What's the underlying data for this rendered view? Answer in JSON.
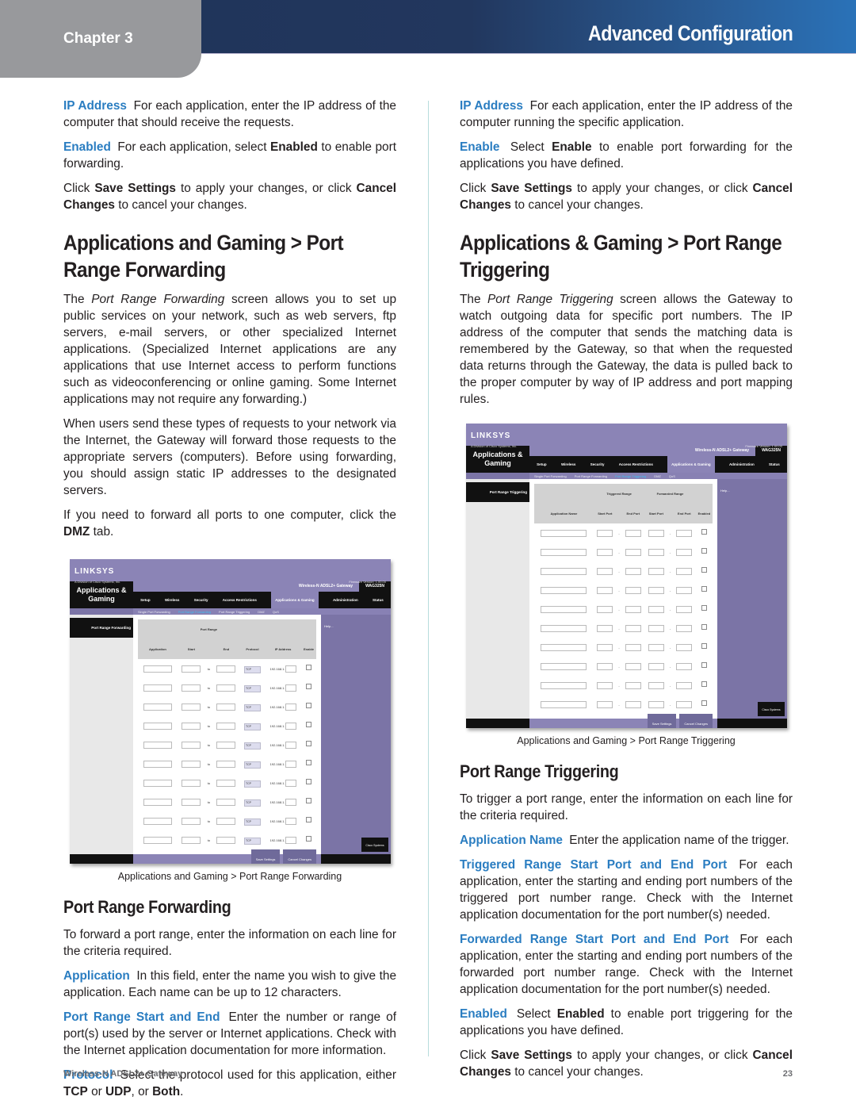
{
  "header": {
    "chapter": "Chapter 3",
    "title": "Advanced Configuration"
  },
  "left": {
    "ip_address": {
      "term": "IP Address",
      "text": "For each application, enter the IP address of the computer that should receive the requests."
    },
    "enabled": {
      "term": "Enabled",
      "text_pre": "For each application, select ",
      "bold": "Enabled",
      "text_post": " to enable port forwarding."
    },
    "save_para": {
      "pre": "Click ",
      "save": "Save Settings",
      "mid": " to apply your changes, or click ",
      "cancel": "Cancel Changes",
      "post": " to cancel your changes."
    },
    "heading": "Applications and Gaming > Port Range Forwarding",
    "intro": {
      "pre": "The ",
      "italic": "Port Range Forwarding",
      "post": " screen allows you to set up public services on your network, such as web servers, ftp servers, e-mail servers, or other specialized Internet applications. (Specialized Internet applications are any applications that use Internet access to perform functions such as videoconferencing or online gaming. Some Internet applications may not require any forwarding.)"
    },
    "para2": "When users send these types of requests to your network via the Internet, the Gateway will forward those requests to the appropriate servers (computers). Before using forwarding, you should assign static IP addresses to the designated servers.",
    "para3": {
      "pre": "If you need to forward all ports to one computer, click the ",
      "bold": "DMZ",
      "post": " tab."
    },
    "caption": "Applications and Gaming > Port Range Forwarding",
    "subheading": "Port Range Forwarding",
    "sub_intro": "To forward a port range, enter the information on each line for the criteria required.",
    "application": {
      "term": "Application",
      "text": "In this field, enter the name you wish to give the application. Each name can be up to 12 characters."
    },
    "port_range": {
      "term": "Port Range Start and End",
      "text": "Enter the number or range of port(s) used by the server or Internet applications. Check with the Internet application documentation for more information."
    },
    "protocol": {
      "term": "Protocol",
      "pre": "Select the protocol used for this application, either ",
      "tcp": "TCP",
      "mid1": " or ",
      "udp": "UDP",
      "mid2": ", or ",
      "both": "Both",
      "post": "."
    }
  },
  "right": {
    "ip_address": {
      "term": "IP Address",
      "text": "For each application, enter the IP address of the computer running the specific application."
    },
    "enable": {
      "term": "Enable",
      "text_pre": "Select ",
      "bold": "Enable",
      "text_post": " to enable port forwarding for the applications you have defined."
    },
    "save_para": {
      "pre": "Click ",
      "save": "Save Settings",
      "mid": " to apply your changes, or click ",
      "cancel": "Cancel Changes",
      "post": " to cancel your changes."
    },
    "heading": "Applications & Gaming > Port Range Triggering",
    "intro": {
      "pre": "The ",
      "italic": "Port Range Triggering",
      "post": " screen allows the Gateway to watch outgoing data for specific port numbers. The IP address of the computer that sends the matching data is remembered by the Gateway, so that when the requested data returns through the Gateway, the data is pulled back to the proper computer by way of IP address and port mapping rules."
    },
    "caption": "Applications and Gaming > Port Range Triggering",
    "subheading": "Port Range Triggering",
    "sub_intro": "To trigger a port range, enter the information on each line for the criteria required.",
    "app_name": {
      "term": "Application Name",
      "text": "Enter the application name of the trigger."
    },
    "triggered": {
      "term": "Triggered Range Start Port and End Port",
      "text": "For each application, enter the starting and ending port numbers of the triggered port number range. Check with the Internet application documentation for the port number(s) needed."
    },
    "forwarded": {
      "term": "Forwarded Range Start Port and End Port",
      "text": "For each application, enter the starting and ending port numbers of the forwarded port number range. Check with the Internet application documentation for the port number(s) needed."
    },
    "enabled": {
      "term": "Enabled",
      "text_pre": "Select ",
      "bold": "Enabled",
      "text_post": " to enable port triggering for the applications you have defined."
    }
  },
  "screenshot_common": {
    "logo": "LINKSYS",
    "logo_sub": "A Division of Cisco Systems, Inc.",
    "firmware": "Firmware Version: 1.00.00",
    "section": "Applications & Gaming",
    "product": "Wireless-N ADSL2+ Gateway",
    "model": "WAG325N",
    "tabs": [
      "Setup",
      "Wireless",
      "Security",
      "Access Restrictions",
      "Applications & Gaming",
      "Administration",
      "Status"
    ],
    "subtabs": [
      "Single Port Forwarding",
      "Port Range Forwarding",
      "Port Range Triggering",
      "DMZ",
      "QoS"
    ],
    "help": "Help...",
    "save_button": "Save Settings",
    "cancel_button": "Cancel Changes",
    "cisco": "Cisco Systems"
  },
  "forwarding_shot": {
    "side_label": "Port Range Forwarding",
    "group_header": "Port Range",
    "columns": [
      "Application",
      "Start",
      "End",
      "Protocol",
      "IP Address",
      "Enable"
    ],
    "to": "to",
    "protocol_value": "TCP",
    "ip_prefix": "192.168.1.",
    "rows": 10
  },
  "triggering_shot": {
    "side_label": "Port Range Triggering",
    "group_headers": [
      "Triggered Range",
      "Forwarded Range"
    ],
    "columns": [
      "Application Name",
      "Start Port",
      "End Port",
      "Start Port",
      "End Port",
      "Enabled"
    ],
    "dash": "-",
    "rows": 10
  },
  "footer": {
    "product": "Wireless-N ADSL2+ Gateway",
    "page": "23"
  }
}
